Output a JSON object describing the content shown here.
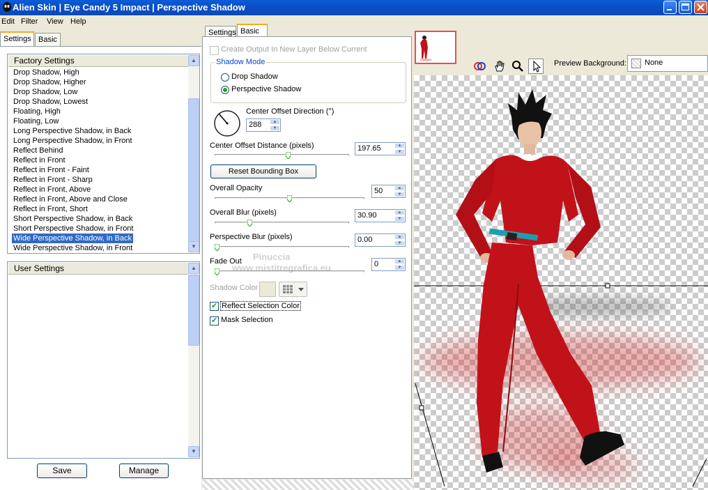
{
  "window": {
    "title": "Alien Skin | Eye Candy 5 Impact | Perspective Shadow"
  },
  "menu": [
    "Edit",
    "Filter",
    "View",
    "Help"
  ],
  "left_tabs": {
    "settings": "Settings",
    "basic": "Basic"
  },
  "factory": {
    "header": "Factory Settings",
    "items": [
      "Drop Shadow, High",
      "Drop Shadow, Higher",
      "Drop Shadow, Low",
      "Drop Shadow, Lowest",
      "Floating, High",
      "Floating, Low",
      "Long Perspective Shadow, in Back",
      "Long Perspective Shadow, in Front",
      "Reflect Behind",
      "Reflect in Front",
      "Reflect in Front - Faint",
      "Reflect in Front - Sharp",
      "Reflect in Front, Above",
      "Reflect in Front, Above and Close",
      "Reflect in Front, Short",
      "Short Perspective Shadow, in Back",
      "Short Perspective Shadow, in Front",
      "Wide Perspective Shadow, in Back",
      "Wide Perspective Shadow, in Front"
    ],
    "selected": "Wide Perspective Shadow, in Back"
  },
  "user": {
    "header": "User Settings"
  },
  "buttons": {
    "save": "Save",
    "manage": "Manage"
  },
  "mid_tabs": {
    "settings": "Settings",
    "basic": "Basic"
  },
  "controls": {
    "create_output": "Create Output In New Layer Below Current",
    "shadow_mode": {
      "title": "Shadow Mode",
      "options": [
        "Drop Shadow",
        "Perspective Shadow"
      ],
      "selected": "Perspective Shadow"
    },
    "direction": {
      "label": "Center Offset Direction (°)",
      "value": "288"
    },
    "distance": {
      "label": "Center Offset Distance (pixels)",
      "value": "197.65",
      "slider": 0.55
    },
    "reset_bounding": "Reset Bounding Box",
    "opacity": {
      "label": "Overall Opacity",
      "value": "50",
      "slider": 0.5
    },
    "blur": {
      "label": "Overall Blur (pixels)",
      "value": "30.90",
      "slider": 0.25
    },
    "persp_blur": {
      "label": "Perspective Blur (pixels)",
      "value": "0.00",
      "slider": 0.0
    },
    "fade_out": {
      "label": "Fade Out",
      "value": "0",
      "slider": 0.0
    },
    "shadow_color": {
      "label": "Shadow Color",
      "swatch": "#ece9d8"
    },
    "reflect_selection": {
      "label": "Reflect Selection Color",
      "checked": true
    },
    "mask_selection": {
      "label": "Mask Selection",
      "checked": true
    }
  },
  "watermark": {
    "line1": "Pinuccia",
    "line2": "www.mistitregrafica.eu"
  },
  "preview_bar": {
    "label": "Preview Background:",
    "value": "None",
    "tools": [
      "preview-toggle-icon",
      "hand-icon",
      "zoom-icon",
      "arrow-icon"
    ]
  },
  "colors": {
    "accent": "#316ac5",
    "shadow": "#c81e1e",
    "suit": "#c1121a"
  }
}
